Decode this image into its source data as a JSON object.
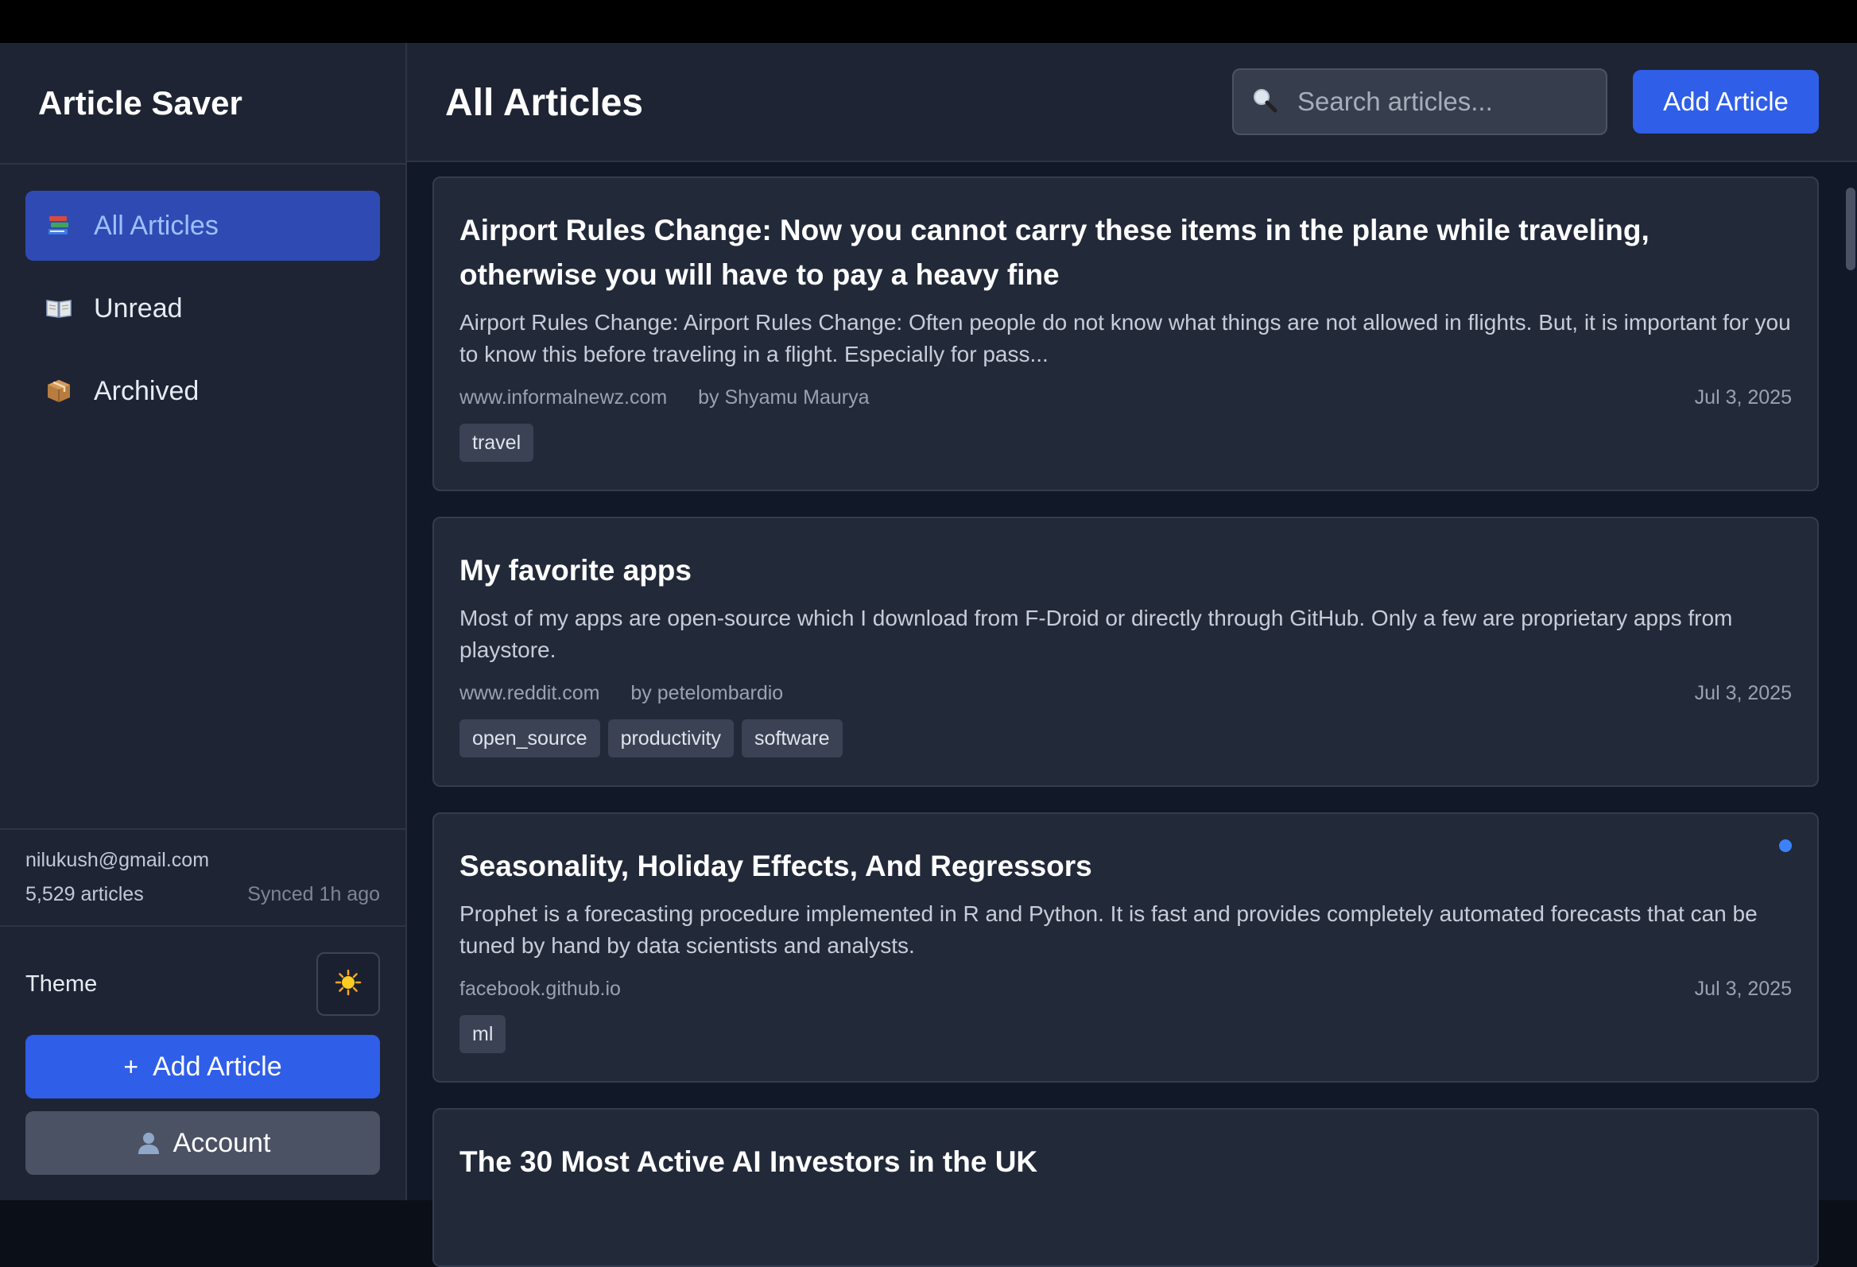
{
  "app": {
    "title": "Article Saver"
  },
  "sidebar": {
    "items": [
      {
        "label": "All Articles",
        "icon": "books-icon",
        "active": true
      },
      {
        "label": "Unread",
        "icon": "open-book-icon",
        "active": false
      },
      {
        "label": "Archived",
        "icon": "package-icon",
        "active": false
      }
    ],
    "user": {
      "email": "nilukush@gmail.com",
      "count": "5,529 articles",
      "sync": "Synced 1h ago"
    },
    "theme_label": "Theme",
    "theme_icon": "sun-icon",
    "add_label": "Add Article",
    "add_icon": "+",
    "account_label": "Account",
    "account_icon": "person-icon"
  },
  "header": {
    "title": "All Articles",
    "search_placeholder": "Search articles...",
    "add_label": "Add Article"
  },
  "articles": [
    {
      "title": "Airport Rules Change: Now you cannot carry these items in the plane while traveling, otherwise you will have to pay a heavy fine",
      "description": "Airport Rules Change: Airport Rules Change: Often people do not know what things are not allowed in flights. But, it is important for you to know this before traveling in a flight. Especially for pass...",
      "domain": "www.informalnewz.com",
      "author": "by Shyamu Maurya",
      "date": "Jul 3, 2025",
      "tags": [
        "travel"
      ],
      "unread": false
    },
    {
      "title": "My favorite apps",
      "description": "Most of my apps are open-source which I download from F-Droid or directly through GitHub. Only a few are proprietary apps from playstore.",
      "domain": "www.reddit.com",
      "author": "by petelombardio",
      "date": "Jul 3, 2025",
      "tags": [
        "open_source",
        "productivity",
        "software"
      ],
      "unread": false
    },
    {
      "title": "Seasonality, Holiday Effects, And Regressors",
      "description": "Prophet is a forecasting procedure implemented in R and Python. It is fast and provides completely automated forecasts that can be tuned by hand by data scientists and analysts.",
      "domain": "facebook.github.io",
      "author": "",
      "date": "Jul 3, 2025",
      "tags": [
        "ml"
      ],
      "unread": true
    },
    {
      "title": "The 30 Most Active AI Investors in the UK",
      "description": "",
      "domain": "",
      "author": "",
      "date": "",
      "tags": [],
      "unread": false
    }
  ],
  "colors": {
    "accent": "#2f5ee8",
    "active_nav_bg": "#2f4bb3",
    "active_nav_text": "#9cc0ff",
    "unread_dot": "#3b82f6",
    "background": "#111827",
    "panel": "#1e2433"
  }
}
